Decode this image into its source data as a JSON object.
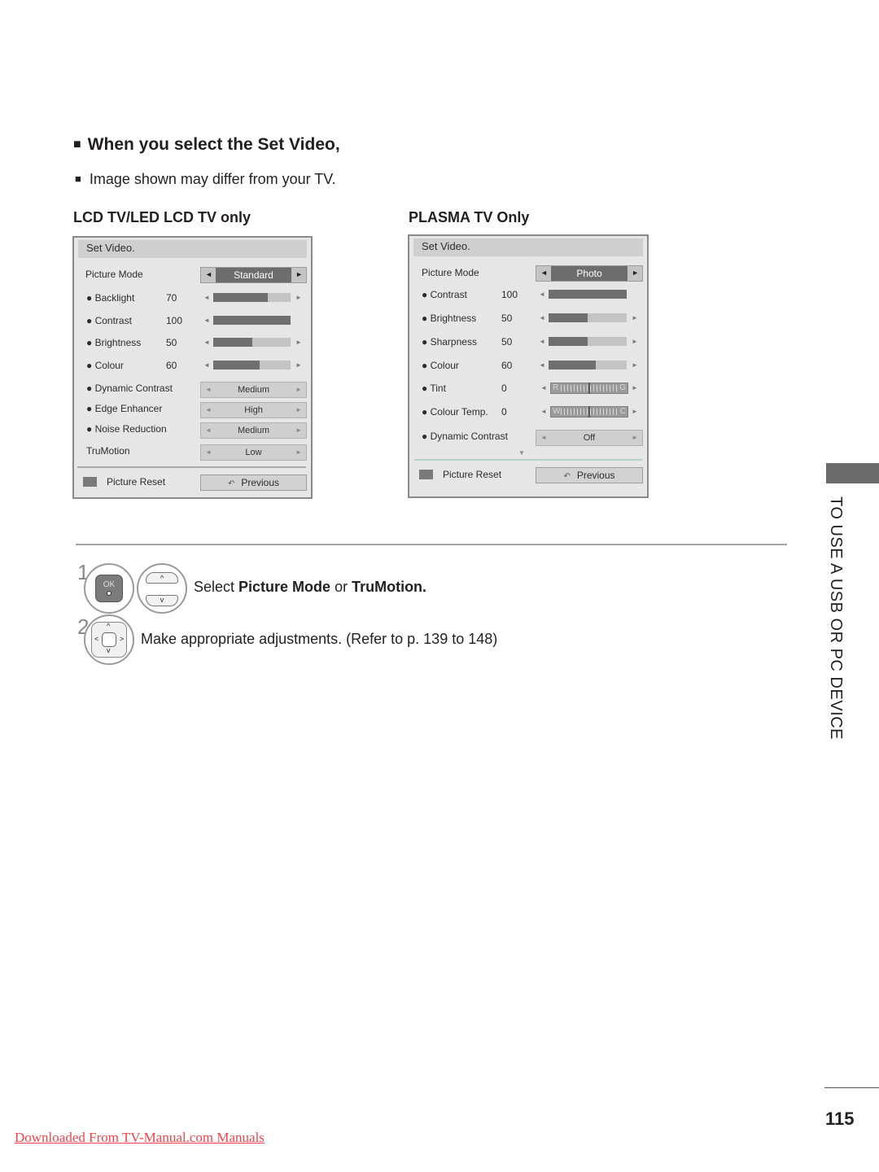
{
  "section": {
    "title": "When you select the Set Video,",
    "note": "Image shown may differ from your TV.",
    "bullet": "■"
  },
  "lcd": {
    "heading": "LCD TV/LED LCD TV only",
    "panel_title": "Set Video.",
    "picture_mode_label": "Picture Mode",
    "picture_mode_value": "Standard",
    "sliders": [
      {
        "label": "● Backlight",
        "value": "70",
        "fill": 0.7,
        "has_right_arrow": true
      },
      {
        "label": "● Contrast",
        "value": "100",
        "fill": 1.0,
        "has_right_arrow": false
      },
      {
        "label": "● Brightness",
        "value": "50",
        "fill": 0.5,
        "has_right_arrow": true
      },
      {
        "label": "● Colour",
        "value": "60",
        "fill": 0.6,
        "has_right_arrow": true
      }
    ],
    "options": [
      {
        "label": "● Dynamic Contrast",
        "value": "Medium"
      },
      {
        "label": "● Edge Enhancer",
        "value": "High"
      },
      {
        "label": "● Noise Reduction",
        "value": "Medium"
      },
      {
        "label": "TruMotion",
        "value": "Low"
      }
    ],
    "reset_label": "Picture Reset",
    "previous_label": "Previous"
  },
  "plasma": {
    "heading": "PLASMA TV Only",
    "panel_title": "Set Video.",
    "picture_mode_label": "Picture Mode",
    "picture_mode_value": "Photo",
    "sliders": [
      {
        "label": "● Contrast",
        "value": "100",
        "fill": 1.0,
        "has_right_arrow": false
      },
      {
        "label": "● Brightness",
        "value": "50",
        "fill": 0.5,
        "has_right_arrow": true
      },
      {
        "label": "● Sharpness",
        "value": "50",
        "fill": 0.5,
        "has_right_arrow": true
      },
      {
        "label": "● Colour",
        "value": "60",
        "fill": 0.6,
        "has_right_arrow": true
      }
    ],
    "gauges": [
      {
        "label": "● Tint",
        "value": "0",
        "left": "R",
        "right": "G",
        "position": 0.5
      },
      {
        "label": "● Colour Temp.",
        "value": "0",
        "left": "W",
        "right": "C",
        "position": 0.5
      }
    ],
    "options": [
      {
        "label": "● Dynamic Contrast",
        "value": "Off"
      }
    ],
    "more_indicator": "▼",
    "reset_label": "Picture Reset",
    "previous_label": "Previous"
  },
  "steps": [
    {
      "number": "1",
      "text_pre": "Select ",
      "bold1": "Picture Mode",
      "text_mid": " or ",
      "bold2": "TruMotion."
    },
    {
      "number": "2",
      "text": "Make appropriate adjustments. (Refer to p. 139 to 148)"
    }
  ],
  "remote": {
    "ok_label": "OK",
    "up": "^",
    "down": "v",
    "left": "<",
    "right": ">"
  },
  "side_tab": {
    "text": "TO USE A USB OR PC DEVICE"
  },
  "page_number": "115",
  "footer_link": "Downloaded From TV-Manual.com Manuals",
  "icons": {
    "arrow_left": "◄",
    "arrow_right": "►",
    "previous_icon": "↶"
  }
}
